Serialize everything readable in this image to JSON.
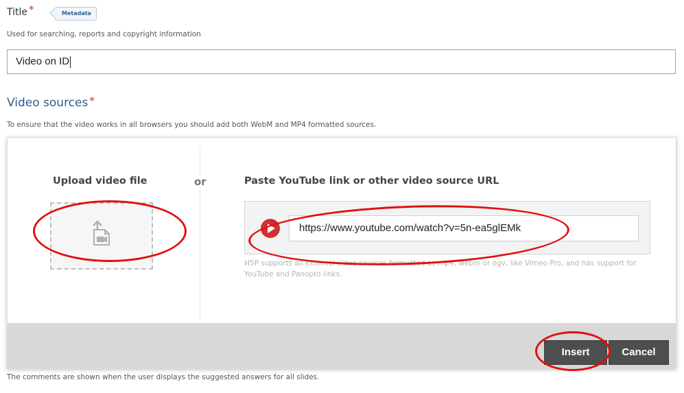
{
  "title_field": {
    "label": "Title",
    "required_marker": "*",
    "metadata_button": "Metadata",
    "description": "Used for searching, reports and copyright information",
    "value": "Video on ID"
  },
  "video_sources": {
    "heading": "Video sources",
    "required_marker": "*",
    "description": "To ensure that the video works in all browsers you should add both WebM and MP4 formatted sources."
  },
  "dialog": {
    "upload_heading": "Upload video file",
    "or_label": "or",
    "paste_heading": "Paste YouTube link or other video source URL",
    "url_value": "https://www.youtube.com/watch?v=5n-ea5glEMk",
    "help_text": "H5P supports all external video sources formatted as mp4, webm or ogv, like Vimeo Pro, and has support for YouTube and Panopto links.",
    "insert_label": "Insert",
    "cancel_label": "Cancel"
  },
  "footer_note": "The comments are shown when the user displays the suggested answers for all slides.",
  "icons": {
    "upload": "upload-video-file-icon",
    "play": "youtube-play-icon"
  },
  "colors": {
    "heading_blue": "#2a5f8c",
    "required_red": "#d0302f",
    "annotation_red": "#e01010",
    "button_dark": "#4e4e4e"
  }
}
